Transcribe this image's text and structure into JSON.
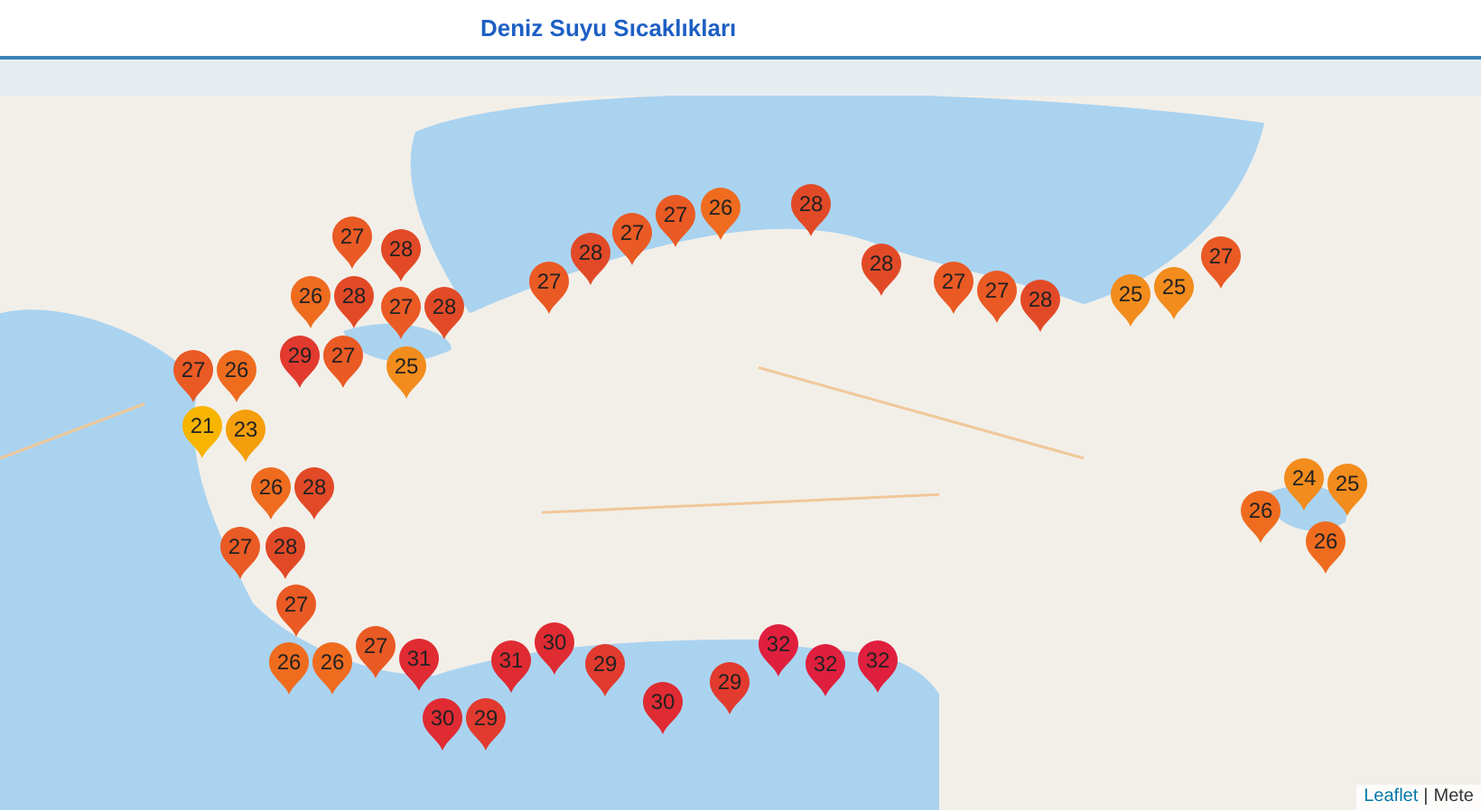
{
  "header": {
    "title": "Deniz Suyu Sıcaklıkları"
  },
  "map": {
    "markers": [
      {
        "label": "27",
        "color": "#ea5a24"
      },
      {
        "label": "28",
        "color": "#e24a27"
      },
      {
        "label": "26",
        "color": "#ef6c1f"
      },
      {
        "label": "28",
        "color": "#e24a27"
      },
      {
        "label": "27",
        "color": "#ea5a24"
      },
      {
        "label": "28",
        "color": "#e24a27"
      },
      {
        "label": "27",
        "color": "#ea5a24"
      },
      {
        "label": "26",
        "color": "#ef6c1f"
      },
      {
        "label": "29",
        "color": "#e23a2e"
      },
      {
        "label": "27",
        "color": "#ea5a24"
      },
      {
        "label": "25",
        "color": "#f28c1c"
      },
      {
        "label": "21",
        "color": "#f7b500"
      },
      {
        "label": "23",
        "color": "#f59e0b"
      },
      {
        "label": "26",
        "color": "#ef6c1f"
      },
      {
        "label": "28",
        "color": "#e24a27"
      },
      {
        "label": "27",
        "color": "#ea5a24"
      },
      {
        "label": "28",
        "color": "#e24a27"
      },
      {
        "label": "27",
        "color": "#ea5a24"
      },
      {
        "label": "27",
        "color": "#ea5a24"
      },
      {
        "label": "26",
        "color": "#ef6c1f"
      },
      {
        "label": "28",
        "color": "#e24a27"
      },
      {
        "label": "28",
        "color": "#e24a27"
      },
      {
        "label": "27",
        "color": "#ea5a24"
      },
      {
        "label": "27",
        "color": "#ea5a24"
      },
      {
        "label": "28",
        "color": "#e24a27"
      },
      {
        "label": "25",
        "color": "#f28c1c"
      },
      {
        "label": "25",
        "color": "#f28c1c"
      },
      {
        "label": "27",
        "color": "#ea5a24"
      },
      {
        "label": "27",
        "color": "#ea5a24"
      },
      {
        "label": "28",
        "color": "#e24a27"
      },
      {
        "label": "27",
        "color": "#ea5a24"
      },
      {
        "label": "26",
        "color": "#ef6c1f"
      },
      {
        "label": "26",
        "color": "#ef6c1f"
      },
      {
        "label": "27",
        "color": "#ea5a24"
      },
      {
        "label": "31",
        "color": "#e02b33"
      },
      {
        "label": "30",
        "color": "#e02b33"
      },
      {
        "label": "29",
        "color": "#e23a2e"
      },
      {
        "label": "31",
        "color": "#e02b33"
      },
      {
        "label": "30",
        "color": "#e02b33"
      },
      {
        "label": "29",
        "color": "#e23a2e"
      },
      {
        "label": "30",
        "color": "#e02b33"
      },
      {
        "label": "29",
        "color": "#e23a2e"
      },
      {
        "label": "32",
        "color": "#e01f3e"
      },
      {
        "label": "32",
        "color": "#e01f3e"
      },
      {
        "label": "32",
        "color": "#e01f3e"
      },
      {
        "label": "24",
        "color": "#f28c1c"
      },
      {
        "label": "26",
        "color": "#ef6c1f"
      },
      {
        "label": "25",
        "color": "#f28c1c"
      },
      {
        "label": "26",
        "color": "#ef6c1f"
      }
    ],
    "attribution": {
      "link": "Leaflet",
      "separator": "|",
      "source": "Mete"
    }
  }
}
